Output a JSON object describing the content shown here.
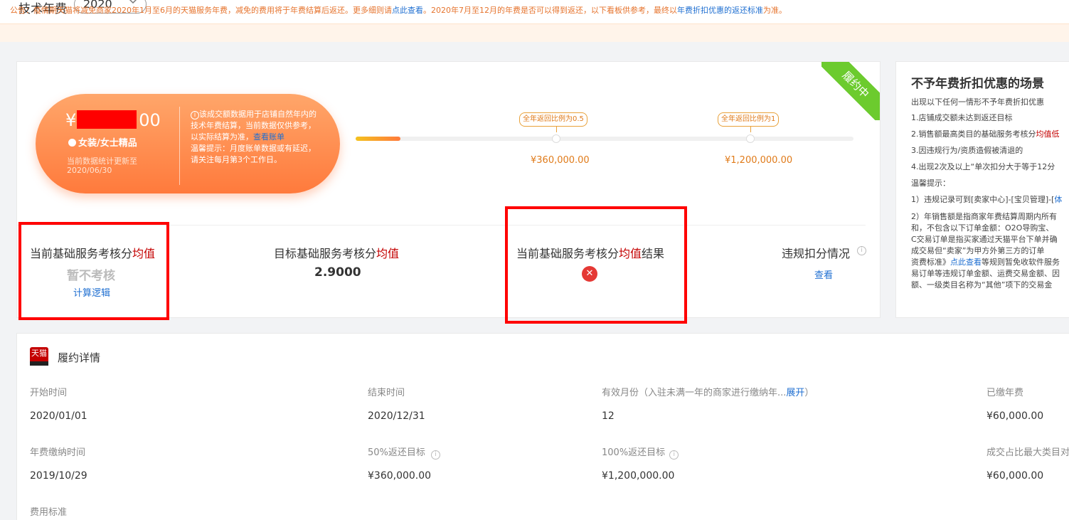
{
  "header": {
    "label": "技术年费",
    "year_value": "2020"
  },
  "notice": {
    "part1": "公告：疫情期天猫将减免商家2020年1月至6月的天猫服务年费，减免的费用将于年费结算后返还。更多细则请",
    "link1": "点此查看",
    "part2": "。2020年7月至12月的年费是否可以得到返还，以下看板供参考，最终以",
    "link2": "年费折扣优惠的返还标准",
    "part3": "为准。"
  },
  "summary": {
    "status_ribbon": "履约中",
    "amount_prefix": "¥",
    "amount_suffix": "00",
    "category": "女装/女士精品",
    "update_line1": "当前数据统计更新至",
    "update_line2": "2020/06/30",
    "note_part1": "该成交额数据用于店铺自然年内的技术年费结算，当前数据仅供参考，以实际结算为准，",
    "note_link": "查看账单",
    "note_part2": "温馨提示：月度账单数据或有延迟，请关注每月第3个工作日。"
  },
  "progress": {
    "fill_ratio": 0.09,
    "milestones": [
      {
        "tag": "全年返回比例为0.5",
        "value": "¥360,000.00"
      },
      {
        "tag": "全年返回比例为1",
        "value": "¥1,200,000.00"
      }
    ]
  },
  "stats": {
    "current_avg_prefix": "当前基础服务考核分",
    "current_avg_red": "均值",
    "current_avg_value": "暂不考核",
    "current_avg_link": "计算逻辑",
    "target_avg_prefix": "目标基础服务考核分",
    "target_avg_red": "均值",
    "target_avg_value": "2.9000",
    "result_prefix": "当前基础服务考核分",
    "result_red": "均值",
    "result_suffix": "结果",
    "result_icon": "✕",
    "violation_title": "违规扣分情况",
    "violation_link": "查看"
  },
  "side": {
    "title": "不予年费折扣优惠的场景",
    "lines": [
      "出现以下任何一情形不予年费折扣优惠",
      "1.店铺成交额未达到返还目标",
      "2.销售额最高类目的基础服务考核分",
      "均值低",
      "3.因违规行为/资质造假被清退的",
      "4.出现2次及以上“单次扣分大于等于12分",
      "温馨提示：",
      "1）违规记录可到[卖家中心]-[宝贝管理]-[",
      "体",
      "2）年销售额是指商家年费结算周期内所有",
      "和，不包含以下订单金额：O2O导购宝、",
      "C交易订单是指买家通过天猫平台下单并确",
      "成交易但“卖家”为甲方外第三方的订单",
      "资费标准》",
      "点此查看",
      "等规则暂免收软件服务",
      "易订单等违规订单金额、运费交易金额、因",
      "额、一级类目名称为“其他”项下的交易金"
    ]
  },
  "detail": {
    "title": "履约详情",
    "logo_text": "天猫",
    "fields": [
      {
        "label": "开始时间",
        "value": "2020/01/01"
      },
      {
        "label": "结束时间",
        "value": "2020/12/31"
      },
      {
        "label": "有效月份（入驻未满一年的商家进行缴纳年...",
        "label_link": "展开",
        "label_tail": "）",
        "value": "12"
      },
      {
        "label": "已缴年费",
        "value": "¥60,000.00"
      },
      {
        "label": "年费缴纳时间",
        "value": "2019/10/29"
      },
      {
        "label": "50%返还目标",
        "value": "¥360,000.00"
      },
      {
        "label": "100%返还目标",
        "value": "¥1,200,000.00"
      },
      {
        "label": "成交占比最大类目对",
        "value": "¥60,000.00"
      },
      {
        "label": "费用标准"
      }
    ]
  }
}
